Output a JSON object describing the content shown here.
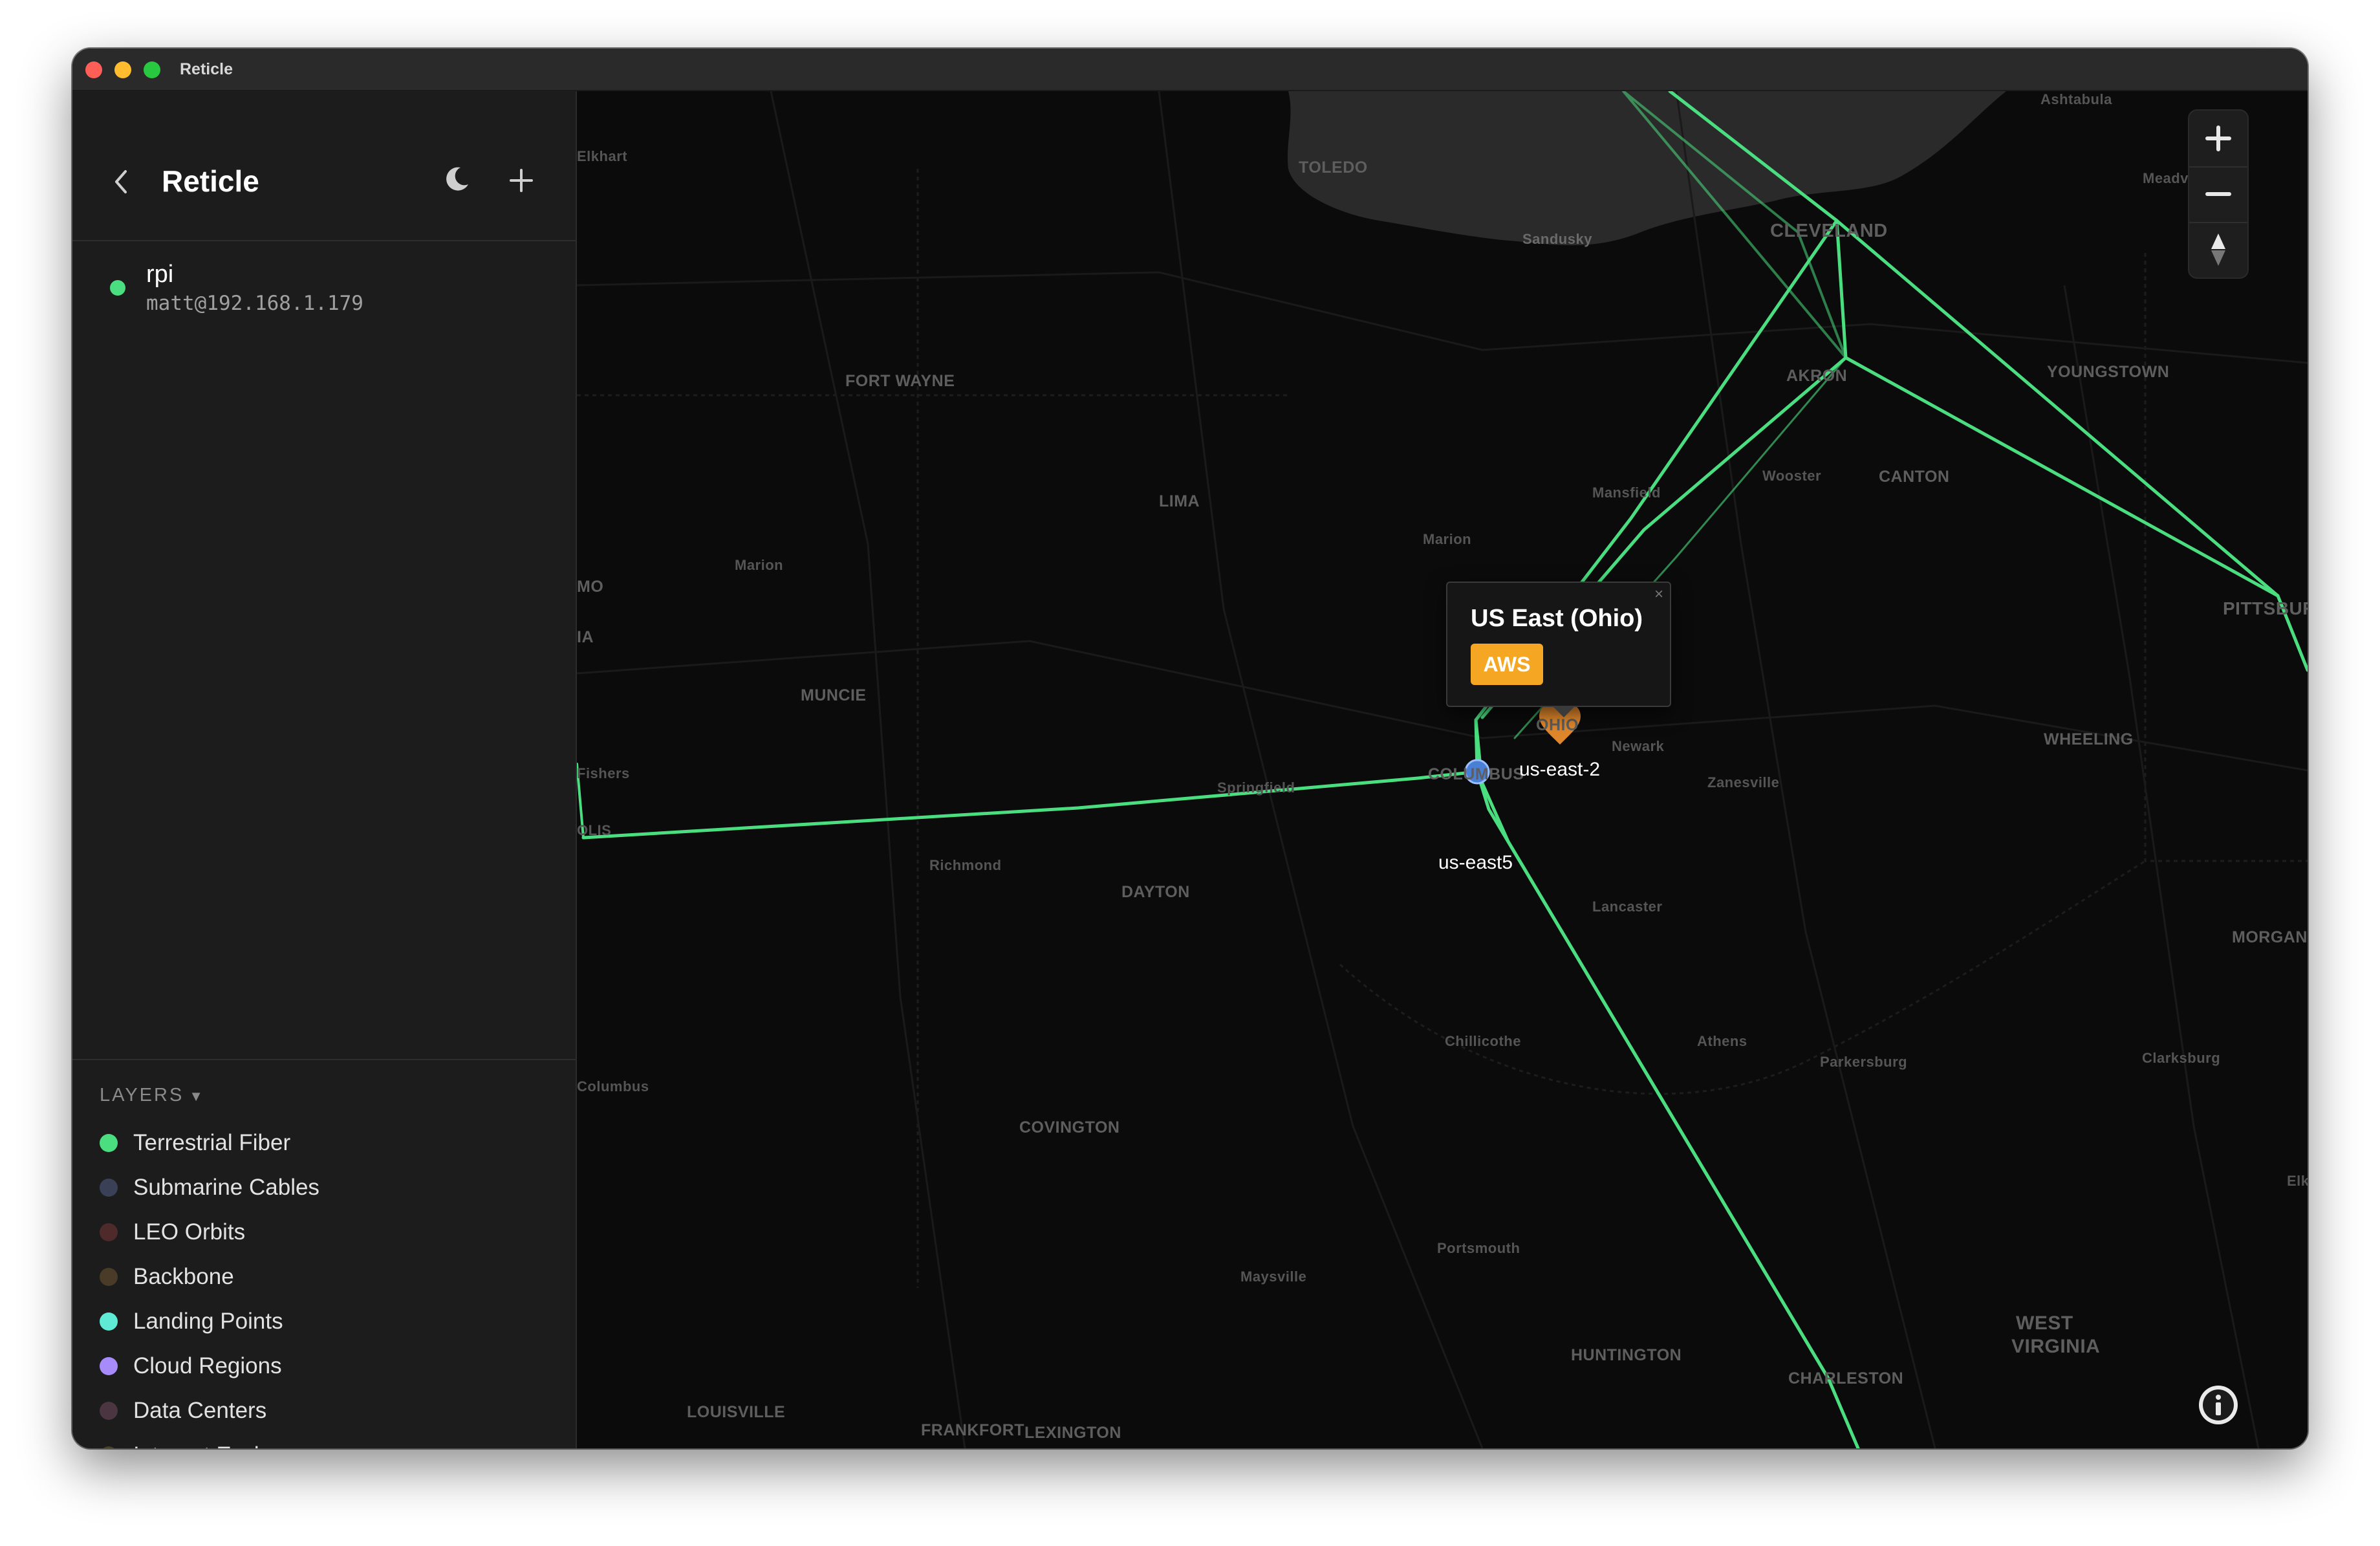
{
  "window": {
    "title": "Reticle"
  },
  "sidebar": {
    "app_title": "Reticle",
    "host": {
      "name": "rpi",
      "address": "matt@192.168.1.179",
      "status_color": "#4ade80"
    },
    "layers_header": "LAYERS",
    "layers": [
      {
        "label": "Terrestrial Fiber",
        "color": "#4ade80",
        "enabled": true
      },
      {
        "label": "Submarine Cables",
        "color": "#3a4157",
        "enabled": false
      },
      {
        "label": "LEO Orbits",
        "color": "#4e2a2a",
        "enabled": false
      },
      {
        "label": "Backbone",
        "color": "#4a3a28",
        "enabled": false
      },
      {
        "label": "Landing Points",
        "color": "#5eead4",
        "enabled": true
      },
      {
        "label": "Cloud Regions",
        "color": "#a78bfa",
        "enabled": true
      },
      {
        "label": "Data Centers",
        "color": "#4a3540",
        "enabled": false
      },
      {
        "label": "Internet Exchanges",
        "color": "#45432c",
        "enabled": false
      }
    ]
  },
  "map": {
    "popup": {
      "title": "US East (Ohio)",
      "badge": "AWS",
      "badge_color": "#f5a623",
      "close": "×"
    },
    "regions": {
      "aws": "us-east-2",
      "other": "us-east5"
    },
    "cities": {
      "toledo": "TOLEDO",
      "cleveland": "CLEVELAND",
      "akron": "AKRON",
      "youngstown": "YOUNGSTOWN",
      "canton": "CANTON",
      "pittsburgh": "PITTSBURGH",
      "wheeling": "WHEELING",
      "morgantown": "MORGANTOWN",
      "fort_wayne": "FORT WAYNE",
      "lima": "LIMA",
      "muncie": "MUNCIE",
      "dayton": "DAYTON",
      "covington": "COVINGTON",
      "louisville": "LOUISVILLE",
      "frankfort": "FRANKFORT",
      "lexington": "LEXINGTON",
      "huntington": "HUNTINGTON",
      "charleston": "CHARLESTON",
      "west": "WEST",
      "virginia": "VIRGINIA",
      "columbus": "COLUMBUS",
      "elkhart": "Elkhart",
      "sandusky": "Sandusky",
      "ashtabula": "Ashtabula",
      "meadville": "Meadville",
      "mansfield": "Mansfield",
      "wooster": "Wooster",
      "marion": "Marion",
      "springfield": "Springfield",
      "richmond": "Richmond",
      "newark": "Newark",
      "zanesville": "Zanesville",
      "lancaster": "Lancaster",
      "chillicothe": "Chillicothe",
      "athens": "Athens",
      "parkersburg": "Parkersburg",
      "clarksburg": "Clarksburg",
      "portsmouth": "Portsmouth",
      "maysville": "Maysville",
      "columbus_in": "Columbus",
      "elkins": "Elkins",
      "ohio": "OHIO",
      "fishers": "Fishers",
      "mo": "MO",
      "ia": "IA",
      "ols": "OLIS"
    }
  }
}
